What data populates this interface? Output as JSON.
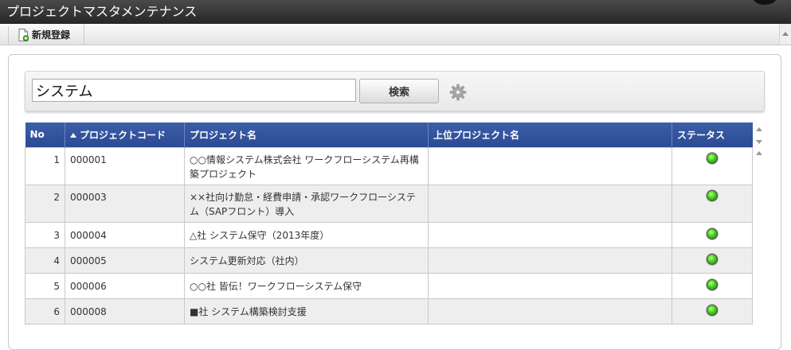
{
  "window": {
    "title": "プロジェクトマスタメンテナンス"
  },
  "toolbar": {
    "new_label": "新規登録",
    "new_icon": "document-add-icon"
  },
  "search": {
    "value": "システム",
    "button_label": "検索",
    "settings_icon": "gear-icon"
  },
  "table": {
    "headers": {
      "no": "No",
      "code": "プロジェクトコード",
      "name": "プロジェクト名",
      "parent": "上位プロジェクト名",
      "status": "ステータス"
    },
    "sort": {
      "column": "code",
      "direction": "ascending"
    },
    "rows": [
      {
        "no": "1",
        "code": "000001",
        "name": "○○情報システム株式会社 ワークフローシステム再構築プロジェクト",
        "parent": "",
        "status": "green"
      },
      {
        "no": "2",
        "code": "000003",
        "name": "××社向け勤怠・経費申請・承認ワークフローシステム（SAPフロント）導入",
        "parent": "",
        "status": "green"
      },
      {
        "no": "3",
        "code": "000004",
        "name": "△社 システム保守（2013年度）",
        "parent": "",
        "status": "green"
      },
      {
        "no": "4",
        "code": "000005",
        "name": "システム更新対応（社内）",
        "parent": "",
        "status": "green"
      },
      {
        "no": "5",
        "code": "000006",
        "name": "○○社 皆伝！ワークフローシステム保守",
        "parent": "",
        "status": "green"
      },
      {
        "no": "6",
        "code": "000008",
        "name": "■社 システム構築検討支援",
        "parent": "",
        "status": "green"
      }
    ]
  },
  "colors": {
    "header_bg": "#2f4f99",
    "title_bg": "#333333",
    "status_on": "#3fd11c"
  }
}
